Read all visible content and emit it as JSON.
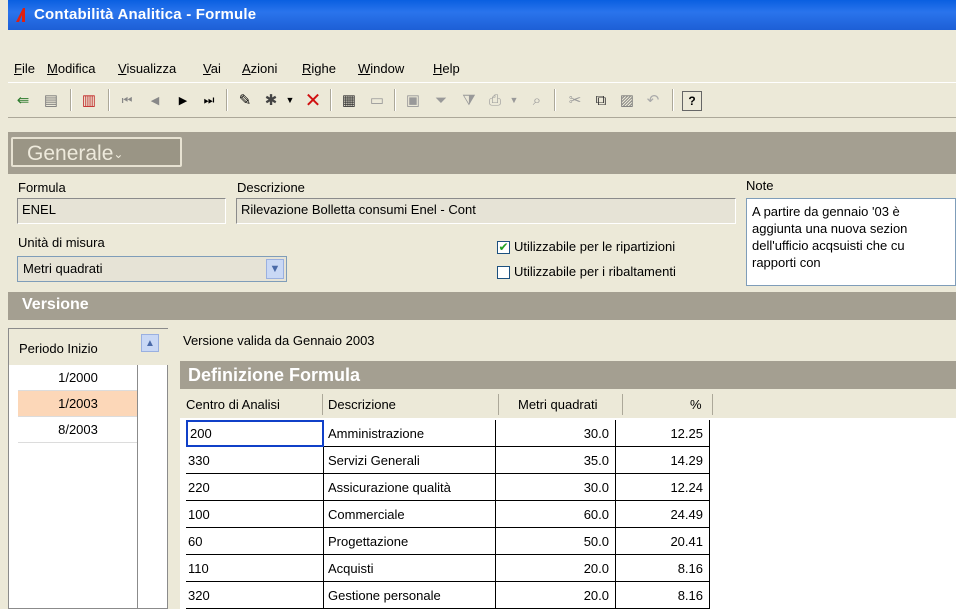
{
  "window": {
    "title": "Contabilità Analitica - Formule"
  },
  "menu": [
    "File",
    "Modifica",
    "Visualizza",
    "Vai",
    "Azioni",
    "Righe",
    "Window",
    "Help"
  ],
  "toolbar": {
    "icons": [
      "exit-icon",
      "properties-icon",
      "report-icon",
      "first-record-icon",
      "prev-record-icon",
      "next-record-icon",
      "last-record-icon",
      "edit-icon",
      "new-record-icon",
      "dropdown-arrow-icon",
      "delete-icon",
      "table-view-icon",
      "form-view-icon",
      "calc-icon",
      "filter-icon",
      "filter-apply-icon",
      "print-icon",
      "print-dropdown-icon",
      "print-preview-icon",
      "cut-icon",
      "copy-icon",
      "paste-icon",
      "undo-icon",
      "help-icon"
    ]
  },
  "section_general": "Generale",
  "form": {
    "formula_label": "Formula",
    "formula_value": "ENEL",
    "descrizione_label": "Descrizione",
    "descrizione_value": "Rilevazione Bolletta consumi Enel - Cont",
    "note_label": "Note",
    "note_lines": [
      "A partire da gennaio '03 è",
      "aggiunta una nuova sezion",
      "dell'ufficio acqsuisti che cu",
      "rapporti con"
    ],
    "unita_label": "Unità di misura",
    "unita_value": "Metri quadrati",
    "check_ripartizioni": {
      "label": "Utilizzabile per le ripartizioni",
      "checked": true
    },
    "check_ribaltamenti": {
      "label": "Utilizzabile per i ribaltamenti",
      "checked": false
    }
  },
  "section_versione": "Versione",
  "periods": {
    "header": "Periodo Inizio",
    "items": [
      "1/2000",
      "1/2003",
      "8/2003"
    ],
    "selected_index": 1
  },
  "version_label": "Versione valida da  Gennaio 2003",
  "section_definizione": "Definizione Formula",
  "table": {
    "columns": [
      "Centro di Analisi",
      "Descrizione",
      "Metri quadrati",
      "%"
    ],
    "rows": [
      [
        "200",
        "Amministrazione",
        "30.0",
        "12.25"
      ],
      [
        "330",
        "Servizi  Generali",
        "35.0",
        "14.29"
      ],
      [
        "220",
        "Assicurazione qualità",
        "30.0",
        "12.24"
      ],
      [
        "100",
        "Commerciale",
        "60.0",
        "24.49"
      ],
      [
        "60",
        "Progettazione",
        "50.0",
        "20.41"
      ],
      [
        "110",
        "Acquisti",
        "20.0",
        "8.16"
      ],
      [
        "320",
        "Gestione personale",
        "20.0",
        "8.16"
      ]
    ]
  }
}
